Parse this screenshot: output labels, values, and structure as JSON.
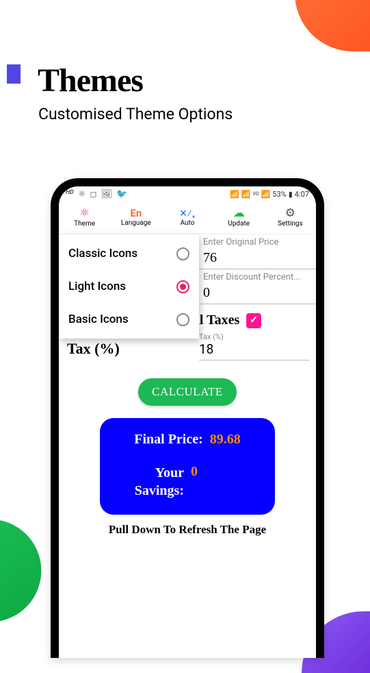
{
  "header": {
    "title": "Themes",
    "subtitle": "Customised Theme Options"
  },
  "status_bar": {
    "hd": "HD",
    "battery": "53%",
    "time": "4:07"
  },
  "toolbar": {
    "theme": {
      "label": "Theme"
    },
    "language": {
      "icon_text": "En",
      "label": "Language"
    },
    "auto": {
      "label": "Auto"
    },
    "update": {
      "label": "Update"
    },
    "settings": {
      "label": "Settings"
    }
  },
  "theme_menu": {
    "options": [
      {
        "label": "Classic Icons",
        "selected": false
      },
      {
        "label": "Light Icons",
        "selected": true
      },
      {
        "label": "Basic Icons",
        "selected": false
      }
    ]
  },
  "form": {
    "original_price": {
      "placeholder": "Enter Original Price",
      "value": "76"
    },
    "discount": {
      "placeholder": "Enter Discount Percent...",
      "value": "0"
    },
    "add_taxes_label": "Add Additional Taxes",
    "add_taxes_checked": true,
    "tax": {
      "label": "Tax (%)",
      "placeholder": "Tax (%)",
      "value": "18"
    },
    "calculate_label": "CALCULATE"
  },
  "result": {
    "final_price_label": "Final Price:",
    "final_price_value": "89.68",
    "savings_label": "Your Savings:",
    "savings_value": "0"
  },
  "footer": {
    "pull_refresh": "Pull Down To Refresh The Page"
  }
}
